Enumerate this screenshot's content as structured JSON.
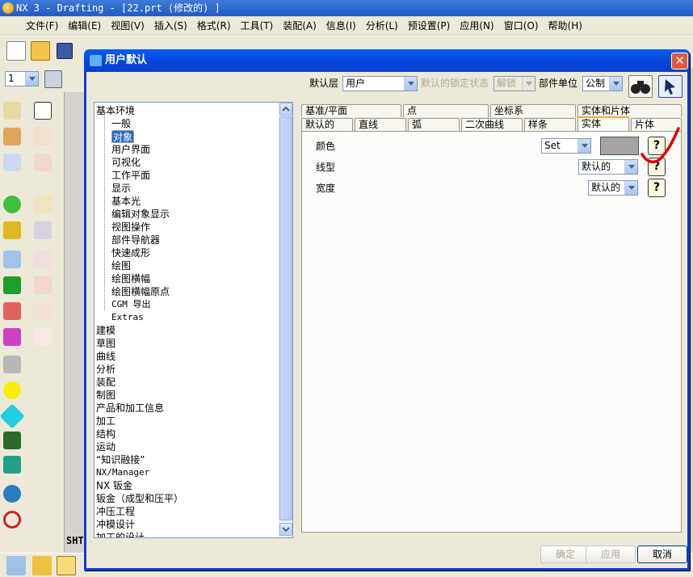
{
  "app": {
    "title": "NX 3 - Drafting - [22.prt  (修改的)  ]"
  },
  "menu": [
    "文件(F)",
    "编辑(E)",
    "视图(V)",
    "插入(S)",
    "格式(R)",
    "工具(T)",
    "装配(A)",
    "信息(I)",
    "分析(L)",
    "预设置(P)",
    "应用(N)",
    "窗口(O)",
    "帮助(H)"
  ],
  "toolbar": {
    "layer_value": "1"
  },
  "dialog": {
    "title": "用户默认",
    "close_label": "✕",
    "filter": {
      "level_label": "默认层",
      "level_value": "用户",
      "lock_label": "默认的锁定状态",
      "lock_value": "解锁",
      "units_label": "部件单位",
      "units_value": "公制"
    },
    "tree": {
      "root_expanded": "基本环境",
      "children": [
        "一般",
        "对象",
        "用户界面",
        "可视化",
        "工作平面",
        "显示",
        "基本光",
        "编辑对象显示",
        "视图操作",
        "部件导航器",
        "快速成形",
        "绘图",
        "绘图横幅",
        "绘图横幅原点",
        "CGM 导出",
        "Extras"
      ],
      "selected_child": "对象",
      "roots": [
        "建模",
        "草图",
        "曲线",
        "分析",
        "装配",
        "制图",
        "产品和加工信息",
        "加工",
        "结构",
        "运动",
        "“知识融接”",
        "NX/Manager",
        "NX 钣金",
        "钣金（成型和压平）",
        "冲压工程",
        "冲模设计",
        "加工的设计"
      ]
    },
    "tabs_row1": [
      "基准/平面",
      "点",
      "坐标系",
      "实体和片体"
    ],
    "tabs_row2": [
      "默认的",
      "直线",
      "弧",
      "二次曲线",
      "样条",
      "实体",
      "片体"
    ],
    "active_tab": "实体",
    "settings": {
      "color_label": "颜色",
      "color_value": "Set",
      "swatch_color": "#a4a4a4",
      "linetype_label": "线型",
      "linetype_value": "默认的",
      "width_label": "宽度",
      "width_value": "默认的",
      "help_label": "?"
    },
    "buttons": {
      "ok": "确定",
      "apply": "应用",
      "cancel": "取消"
    }
  },
  "status": {
    "sheet_label": "SHT"
  }
}
